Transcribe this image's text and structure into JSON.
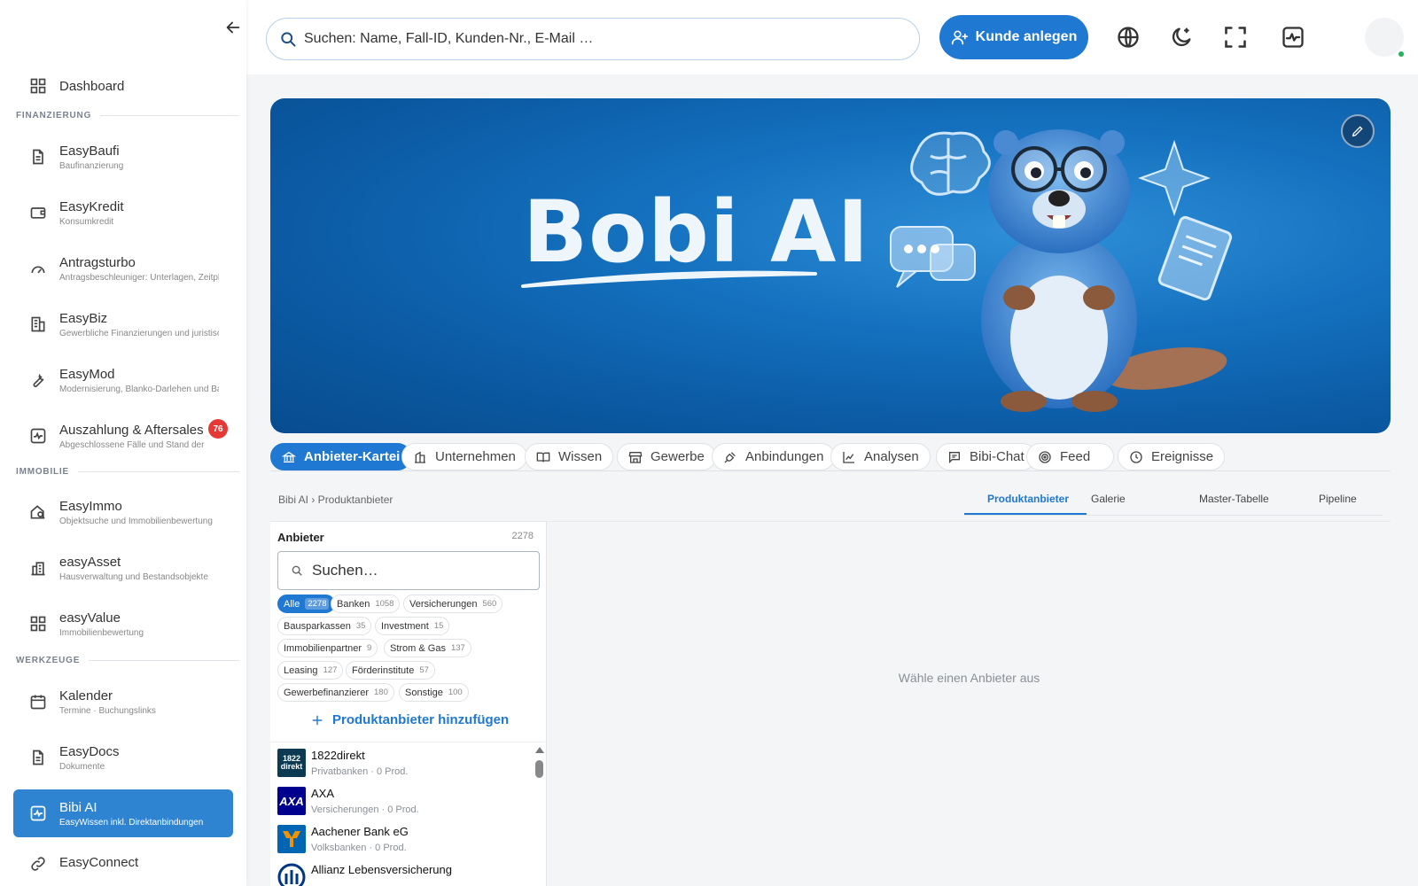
{
  "sidebar": {
    "items": [
      {
        "label": "Dashboard",
        "sub": ""
      },
      {
        "label": "EasyBaufi",
        "sub": "Baufinanzierung"
      },
      {
        "label": "EasyKredit",
        "sub": "Konsumkredit"
      },
      {
        "label": "Antragsturbo",
        "sub": "Antragsbeschleuniger: Unterlagen, Zeitpla"
      },
      {
        "label": "EasyBiz",
        "sub": "Gewerbliche Finanzierungen und juristisch"
      },
      {
        "label": "EasyMod",
        "sub": "Modernisierung, Blanko-Darlehen und Bau"
      },
      {
        "label": "Auszahlung & Aftersales",
        "sub": "Abgeschlossene Fälle und Stand der",
        "badge": "76"
      },
      {
        "label": "EasyImmo",
        "sub": "Objektsuche und Immobilienbewertung"
      },
      {
        "label": "easyAsset",
        "sub": "Hausverwaltung und Bestandsobjekte"
      },
      {
        "label": "easyValue",
        "sub": "Immobilienbewertung"
      },
      {
        "label": "Kalender",
        "sub": "Termine · Buchungslinks"
      },
      {
        "label": "EasyDocs",
        "sub": "Dokumente"
      },
      {
        "label": "Bibi AI",
        "sub": "EasyWissen inkl. Direktanbindungen"
      },
      {
        "label": "EasyConnect",
        "sub": ""
      }
    ],
    "sections": {
      "finanzierung": "FINANZIERUNG",
      "immobilie": "IMMOBILIE",
      "werkzeuge": "WERKZEUGE"
    }
  },
  "header": {
    "search_placeholder": "Suchen: Name, Fall-ID, Kunden-Nr., E-Mail …",
    "create_customer_label": "Kunde anlegen",
    "icons": [
      "globe-icon",
      "moon-icon",
      "fullscreen-icon",
      "activity-icon"
    ]
  },
  "banner": {
    "title": "Bobi AI"
  },
  "tabs": [
    {
      "label": "Anbieter-Kartei",
      "icon": "bank-icon"
    },
    {
      "label": "Unternehmen",
      "icon": "building-icon"
    },
    {
      "label": "Wissen",
      "icon": "book-icon"
    },
    {
      "label": "Gewerbe",
      "icon": "store-icon"
    },
    {
      "label": "Anbindungen",
      "icon": "plug-icon"
    },
    {
      "label": "Analysen",
      "icon": "chart-icon"
    },
    {
      "label": "Bibi-Chat",
      "icon": "chat-icon"
    },
    {
      "label": "Feed",
      "icon": "feed-icon"
    },
    {
      "label": "Ereignisse",
      "icon": "clock-icon"
    }
  ],
  "breadcrumb": "Bibi AI › Produktanbieter",
  "subtabs": [
    "Produktanbieter",
    "Galerie",
    "Master-Tabelle",
    "Pipeline"
  ],
  "providers_panel": {
    "title": "Anbieter",
    "count": "2278",
    "search_placeholder": "Suchen…",
    "filters": [
      {
        "label": "Alle",
        "count": "2278"
      },
      {
        "label": "Banken",
        "count": "1058"
      },
      {
        "label": "Versicherungen",
        "count": "560"
      },
      {
        "label": "Bausparkassen",
        "count": "35"
      },
      {
        "label": "Investment",
        "count": "15"
      },
      {
        "label": "Immobilienpartner",
        "count": "9"
      },
      {
        "label": "Strom & Gas",
        "count": "137"
      },
      {
        "label": "Leasing",
        "count": "127"
      },
      {
        "label": "Förderinstitute",
        "count": "57"
      },
      {
        "label": "Gewerbefinanzierer",
        "count": "180"
      },
      {
        "label": "Sonstige",
        "count": "100"
      }
    ],
    "add_label": "Produktanbieter hinzufügen",
    "providers": [
      {
        "name": "1822direkt",
        "meta": "Privatbanken · 0 Prod.",
        "logo_text": "1822 direkt",
        "color": "#0c3a53"
      },
      {
        "name": "AXA",
        "meta": "Versicherungen · 0 Prod.",
        "logo_text": "AXA",
        "color": "#00008f"
      },
      {
        "name": "Aachener Bank eG",
        "meta": "Volksbanken · 0 Prod.",
        "logo_text": "",
        "color": "#0066b3"
      },
      {
        "name": "Allianz Lebensversicherung",
        "meta": "",
        "logo_text": "",
        "color": "#003781"
      }
    ]
  },
  "empty_state": "Wähle einen Anbieter aus"
}
